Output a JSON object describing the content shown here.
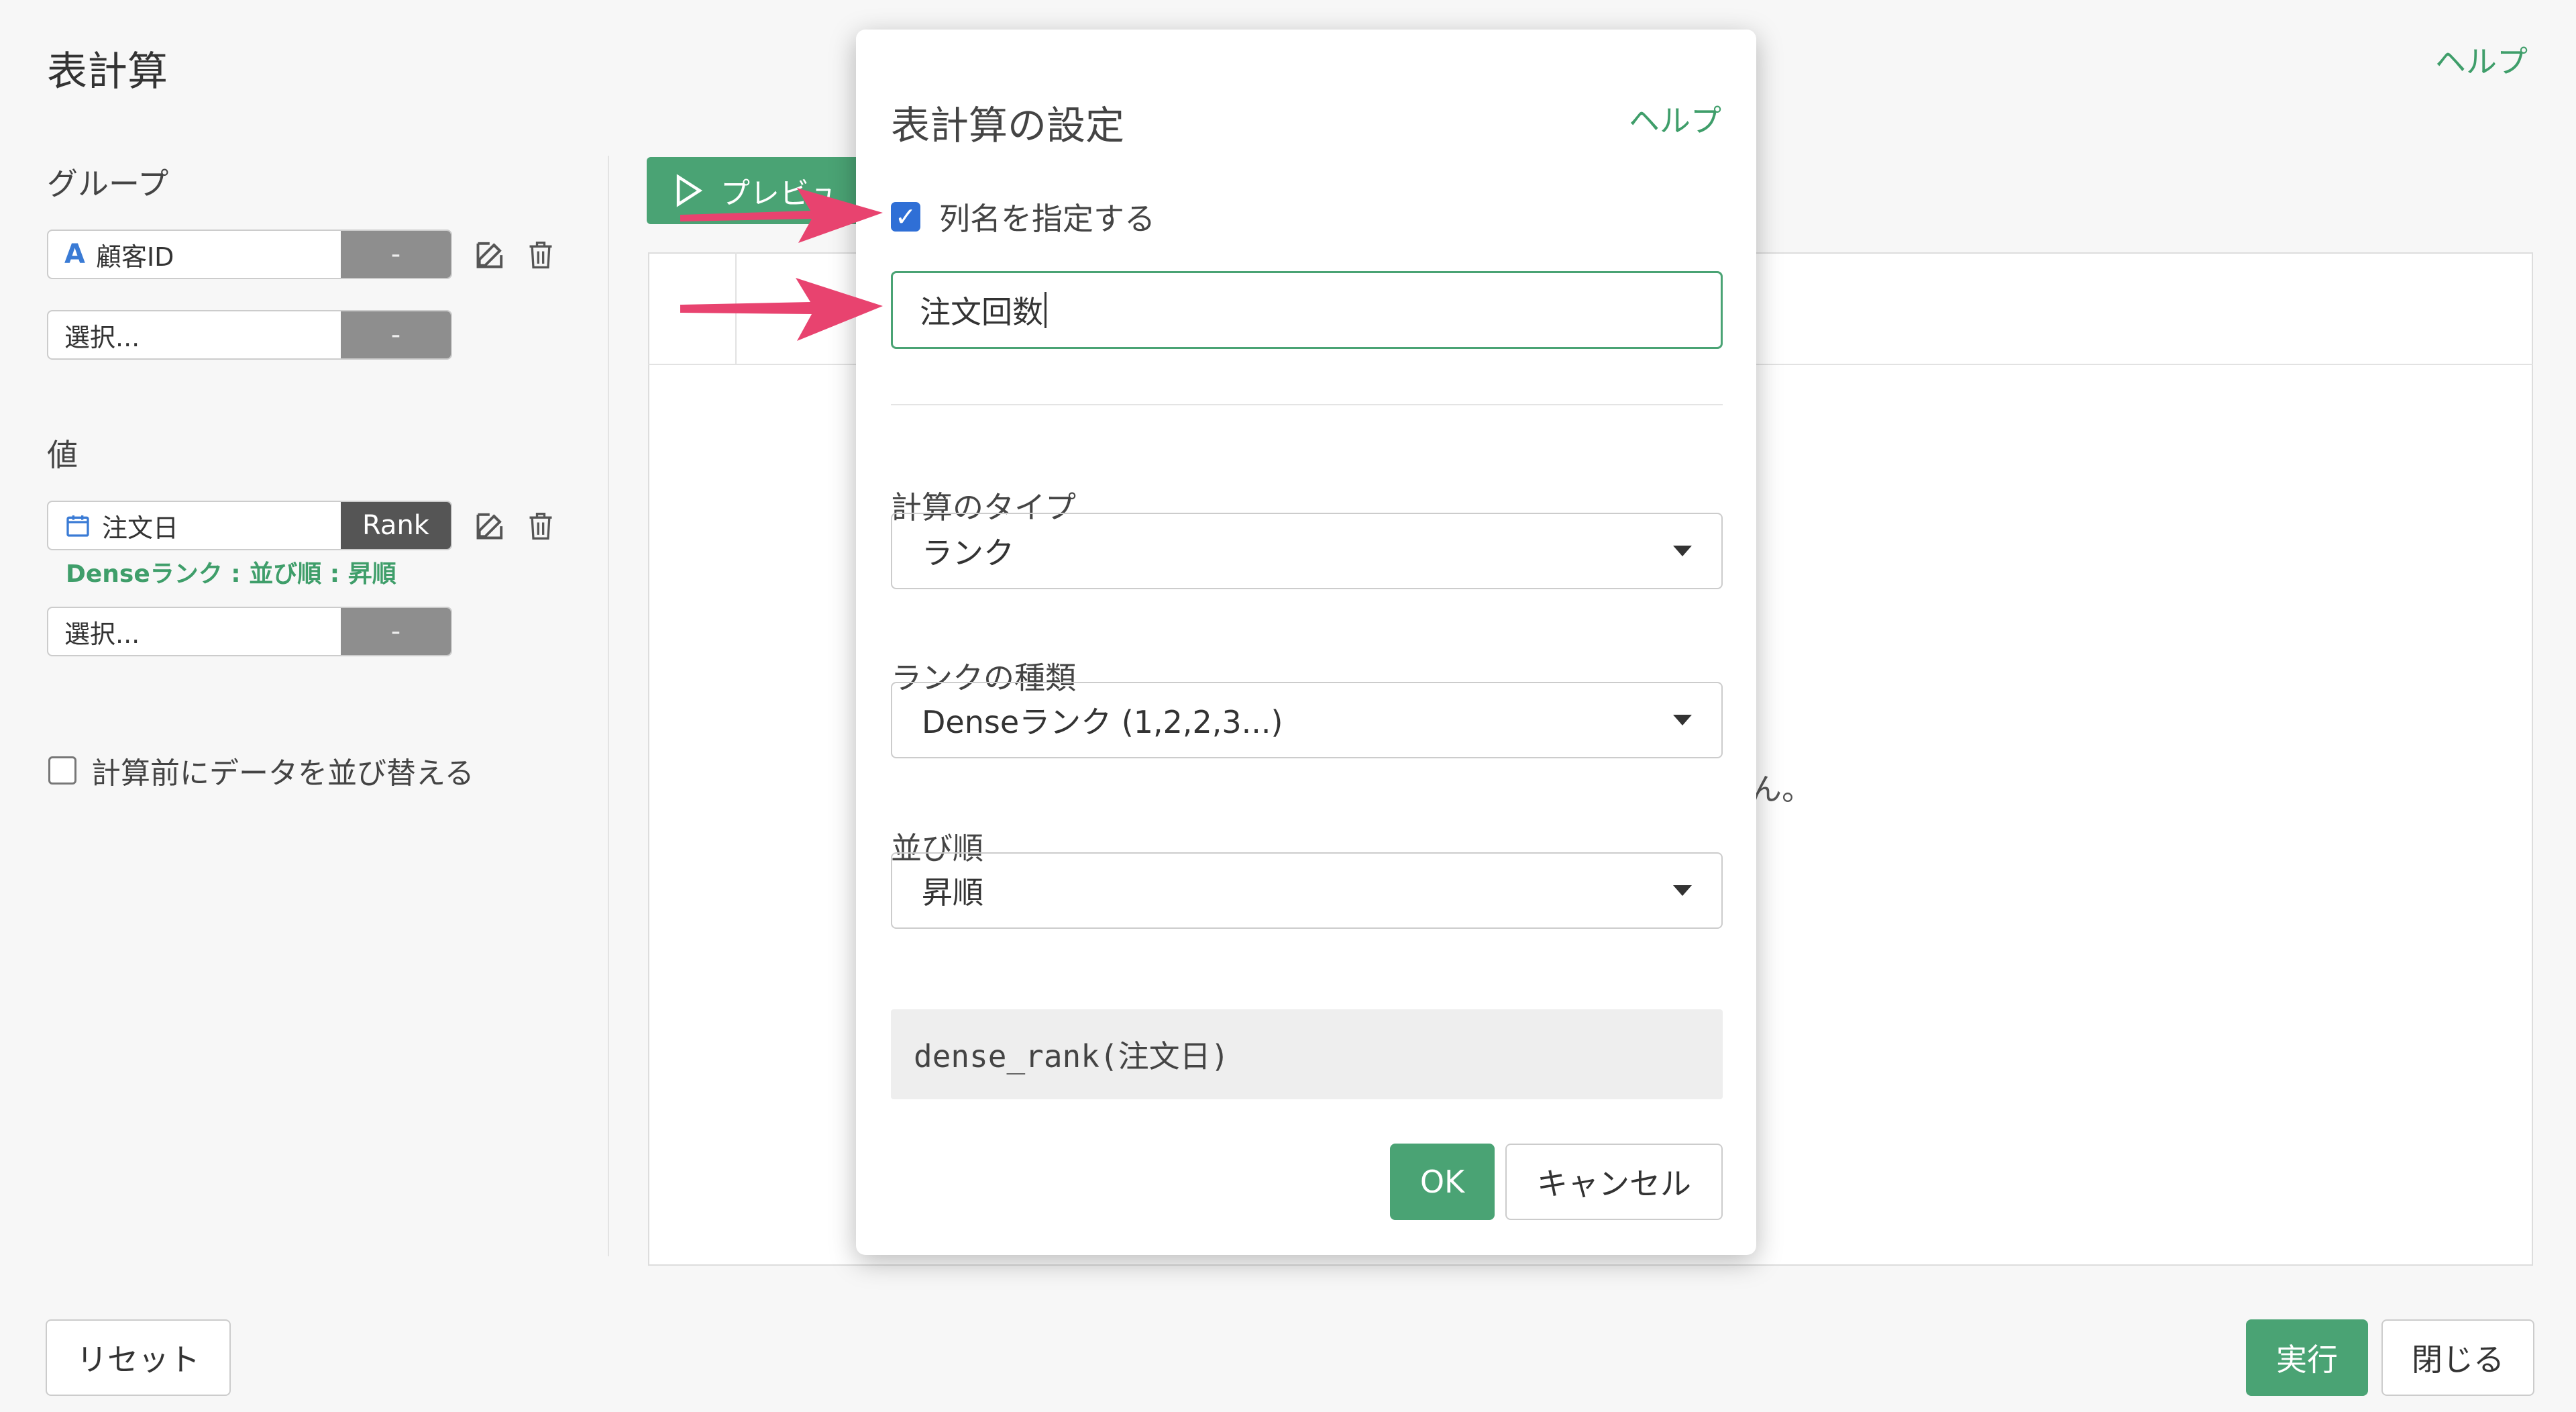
{
  "page": {
    "title": "表計算",
    "help": "ヘルプ"
  },
  "left": {
    "group_label": "グループ",
    "group_items": [
      {
        "icon": "A",
        "text": "顧客ID",
        "action": "-"
      },
      {
        "text": "選択...",
        "action": "-"
      }
    ],
    "value_label": "値",
    "value_items": [
      {
        "text": "注文日",
        "action": "Rank",
        "subnote": "Denseランク : 並び順 : 昇順"
      },
      {
        "text": "選択...",
        "action": "-"
      }
    ],
    "sort_checkbox_label": "計算前にデータを並び替える"
  },
  "main": {
    "preview_label": "プレビュ",
    "empty_message_tail": "ん。"
  },
  "footer": {
    "reset": "リセット",
    "run": "実行",
    "close": "閉じる"
  },
  "modal": {
    "title": "表計算の設定",
    "help": "ヘルプ",
    "specify_name_label": "列名を指定する",
    "specify_name_checked": true,
    "column_name_value": "注文回数",
    "calc_type_label": "計算のタイプ",
    "calc_type_value": "ランク",
    "rank_type_label": "ランクの種類",
    "rank_type_value": "Denseランク (1,2,2,3...)",
    "order_label": "並び順",
    "order_value": "昇順",
    "expression": "dense_rank(注文日)",
    "ok": "OK",
    "cancel": "キャンセル"
  },
  "colors": {
    "accent_green": "#4aa374",
    "arrow_pink": "#e8436f",
    "checkbox_blue": "#2f6fd6"
  }
}
